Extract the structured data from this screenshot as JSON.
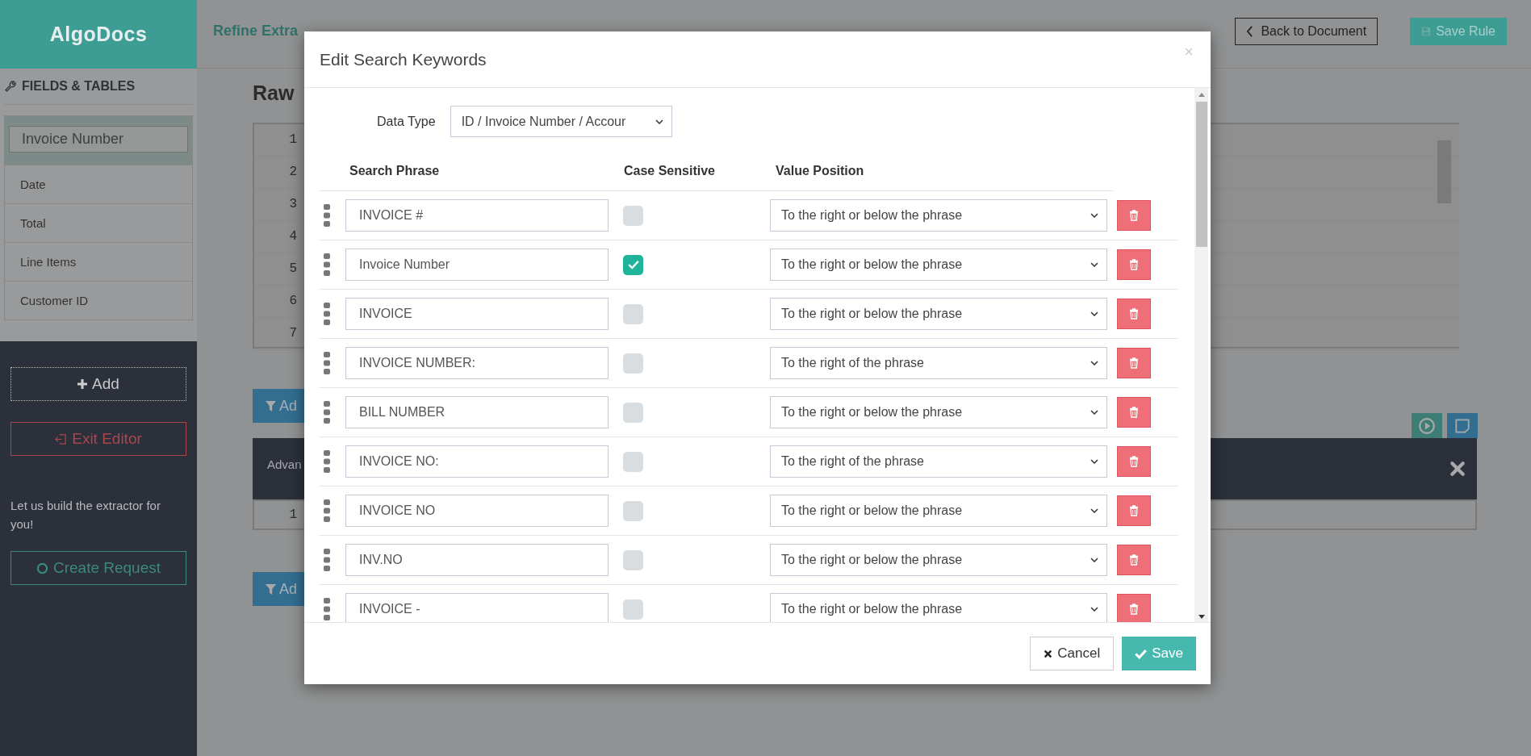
{
  "app": {
    "logo": "AlgoDocs"
  },
  "header": {
    "title": "Refine Extra",
    "back_button": "Back to Document",
    "save_button": "Save Rule"
  },
  "sidebar": {
    "heading": "FIELDS & TABLES",
    "items": [
      {
        "label": "Invoice Number",
        "selected": true
      },
      {
        "label": "Date",
        "selected": false
      },
      {
        "label": "Total",
        "selected": false
      },
      {
        "label": "Line Items",
        "selected": false
      },
      {
        "label": "Customer ID",
        "selected": false
      }
    ],
    "add_button": "Add",
    "exit_button": "Exit Editor",
    "promo_text": "Let us build the extractor for you!",
    "request_button": "Create Request"
  },
  "page": {
    "heading": "Raw",
    "line_numbers": [
      "1",
      "2",
      "3",
      "4",
      "5",
      "6",
      "7"
    ],
    "filter_buttons": [
      "Ad",
      "Ad"
    ],
    "advanced_label": "Advan",
    "result_row_number": "1"
  },
  "modal": {
    "title": "Edit Search Keywords",
    "data_type_label": "Data Type",
    "data_type_value": "ID / Invoice Number / Accour",
    "columns": [
      "Search Phrase",
      "Case Sensitive",
      "Value Position"
    ],
    "rows": [
      {
        "phrase": "INVOICE #",
        "case_sensitive": false,
        "position": "To the right or below the phrase"
      },
      {
        "phrase": "Invoice Number",
        "case_sensitive": true,
        "position": "To the right or below the phrase"
      },
      {
        "phrase": "INVOICE",
        "case_sensitive": false,
        "position": "To the right or below the phrase"
      },
      {
        "phrase": "INVOICE NUMBER:",
        "case_sensitive": false,
        "position": "To the right of the phrase"
      },
      {
        "phrase": "BILL NUMBER",
        "case_sensitive": false,
        "position": "To the right or below the phrase"
      },
      {
        "phrase": "INVOICE NO:",
        "case_sensitive": false,
        "position": "To the right of the phrase"
      },
      {
        "phrase": "INVOICE NO",
        "case_sensitive": false,
        "position": "To the right or below the phrase"
      },
      {
        "phrase": "INV.NO",
        "case_sensitive": false,
        "position": "To the right or below the phrase"
      },
      {
        "phrase": "INVOICE -",
        "case_sensitive": false,
        "position": "To the right or below the phrase"
      }
    ],
    "cancel_button": "Cancel",
    "save_button": "Save"
  }
}
